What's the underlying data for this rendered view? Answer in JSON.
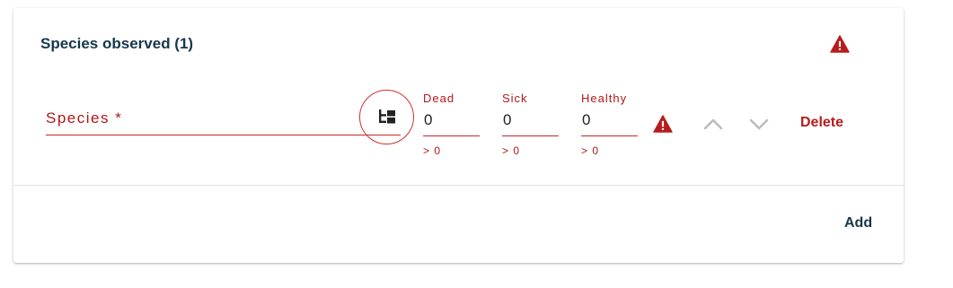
{
  "section": {
    "title": "Species observed (1)"
  },
  "row": {
    "species_label": "Species *",
    "fields": {
      "dead": {
        "label": "Dead",
        "value": "0",
        "hint": "> 0"
      },
      "sick": {
        "label": "Sick",
        "value": "0",
        "hint": "> 0"
      },
      "healthy": {
        "label": "Healthy",
        "value": "0",
        "hint": "> 0"
      }
    },
    "delete_label": "Delete"
  },
  "footer": {
    "add_label": "Add"
  },
  "icons": {
    "header_status": "warning-icon",
    "row_status": "warning-icon",
    "species_picker": "tree-icon",
    "move_up": "chevron-up-icon",
    "move_down": "chevron-down-icon"
  },
  "colors": {
    "error": "#c62828",
    "error_text": "#b01818",
    "title_text": "#17374a",
    "disabled_chevron": "#bdbdbd"
  }
}
